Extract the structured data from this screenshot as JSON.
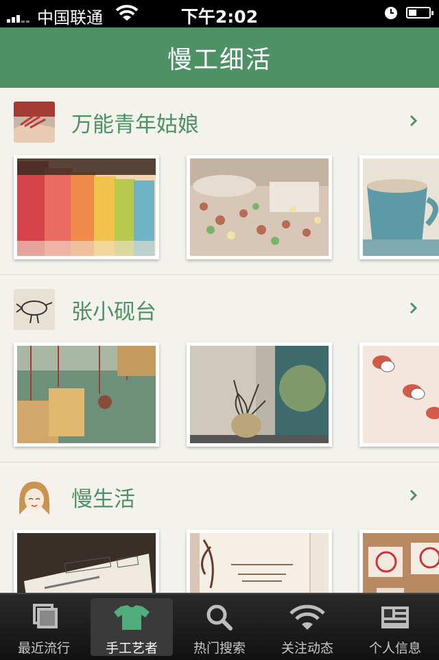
{
  "status_bar": {
    "carrier": "中国联通",
    "time": "下午2:02"
  },
  "nav": {
    "title": "慢工细活"
  },
  "sections": [
    {
      "title": "万能青年姑娘",
      "avatar_icon": "hand-avatar-icon",
      "photos": [
        "button-jars-photo",
        "miniature-sweets-photo",
        "cup-photo"
      ]
    },
    {
      "title": "张小砚台",
      "avatar_icon": "bird-drawing-avatar-icon",
      "photos": [
        "wooden-charms-photo",
        "vase-branch-photo",
        "figurines-photo"
      ]
    },
    {
      "title": "慢生活",
      "avatar_icon": "cartoon-girl-avatar-icon",
      "photos": [
        "business-card-photo",
        "wedding-invitation-photo",
        "stamps-photo"
      ]
    }
  ],
  "tabs": [
    {
      "label": "最近流行",
      "icon": "layers-icon",
      "active": false
    },
    {
      "label": "手工艺者",
      "icon": "tshirt-icon",
      "active": true
    },
    {
      "label": "热门搜索",
      "icon": "search-icon",
      "active": false
    },
    {
      "label": "关注动态",
      "icon": "wifi-icon",
      "active": false
    },
    {
      "label": "个人信息",
      "icon": "profile-card-icon",
      "active": false
    }
  ],
  "colors": {
    "accent": "#4d9164",
    "background": "#f3f2ec",
    "tabbar": "#1a1a1a"
  }
}
